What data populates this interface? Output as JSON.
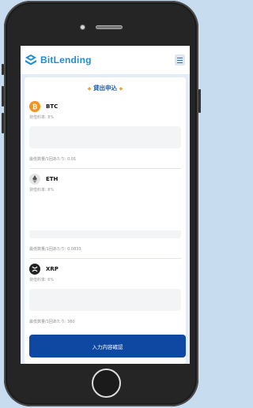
{
  "header": {
    "brand": "BitLending",
    "menu_icon": "hamburger-icon"
  },
  "form": {
    "title": "貸出申込",
    "submit_label": "入力内容確認"
  },
  "coins": [
    {
      "symbol": "BTC",
      "rate": "貸借料率: 8%",
      "min_qty": "最低数量/1回あたり: 0.01",
      "icon": "bitcoin-icon",
      "color": "#f7931a"
    },
    {
      "symbol": "ETH",
      "rate": "貸借料率: 8%",
      "min_qty": "最低数量/1回あたり: 0.0833",
      "icon": "ethereum-icon",
      "color": "#e8e8e8"
    },
    {
      "symbol": "XRP",
      "rate": "貸借料率: 6%",
      "min_qty": "最低数量/1回あたり: 360",
      "icon": "xrp-icon",
      "color": "#222222"
    }
  ],
  "colors": {
    "brand": "#1d8fd6",
    "button": "#0f48a3",
    "background": "#c7dcef"
  }
}
